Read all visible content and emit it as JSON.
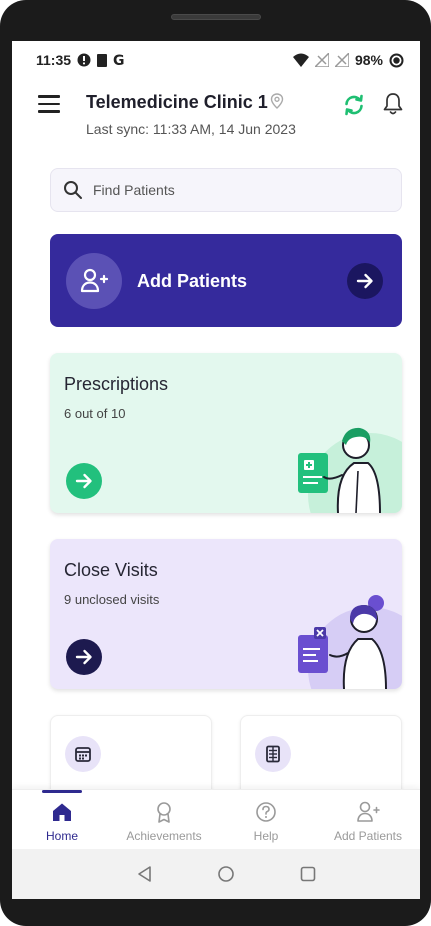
{
  "status_bar": {
    "time": "11:35",
    "battery": "98%",
    "left_icons": [
      "alert-circle-icon",
      "sim-icon",
      "g-icon"
    ],
    "right_icons": [
      "wifi-icon",
      "signal-icon",
      "signal-icon",
      "battery-icon"
    ]
  },
  "header": {
    "title": "Telemedicine Clinic 1",
    "last_sync": "Last sync: 11:33 AM, 14 Jun 2023",
    "icons": [
      "menu-icon",
      "location-icon",
      "sync-icon",
      "bell-icon"
    ]
  },
  "search": {
    "placeholder": "Find Patients",
    "value": ""
  },
  "add_card": {
    "label": "Add Patients",
    "color": "#352a9c"
  },
  "prescriptions_card": {
    "title": "Prescriptions",
    "subtitle": "6 out of 10",
    "color": "#e3f8ee",
    "accent": "#22c07d"
  },
  "close_visits_card": {
    "title": "Close Visits",
    "subtitle": "9 unclosed visits",
    "color": "#ece6fb",
    "accent": "#1d1a4f"
  },
  "mini_cards": [
    {
      "icon": "calendar-icon"
    },
    {
      "icon": "document-icon"
    }
  ],
  "bottom_nav": {
    "items": [
      {
        "label": "Home",
        "icon": "home-icon",
        "active": true
      },
      {
        "label": "Achievements",
        "icon": "award-icon",
        "active": false
      },
      {
        "label": "Help",
        "icon": "help-icon",
        "active": false
      },
      {
        "label": "Add Patients",
        "icon": "add-user-icon",
        "active": false
      }
    ],
    "active_color": "#2f2a8f"
  },
  "system_nav": [
    "back-icon",
    "home-circle-icon",
    "recents-icon"
  ]
}
